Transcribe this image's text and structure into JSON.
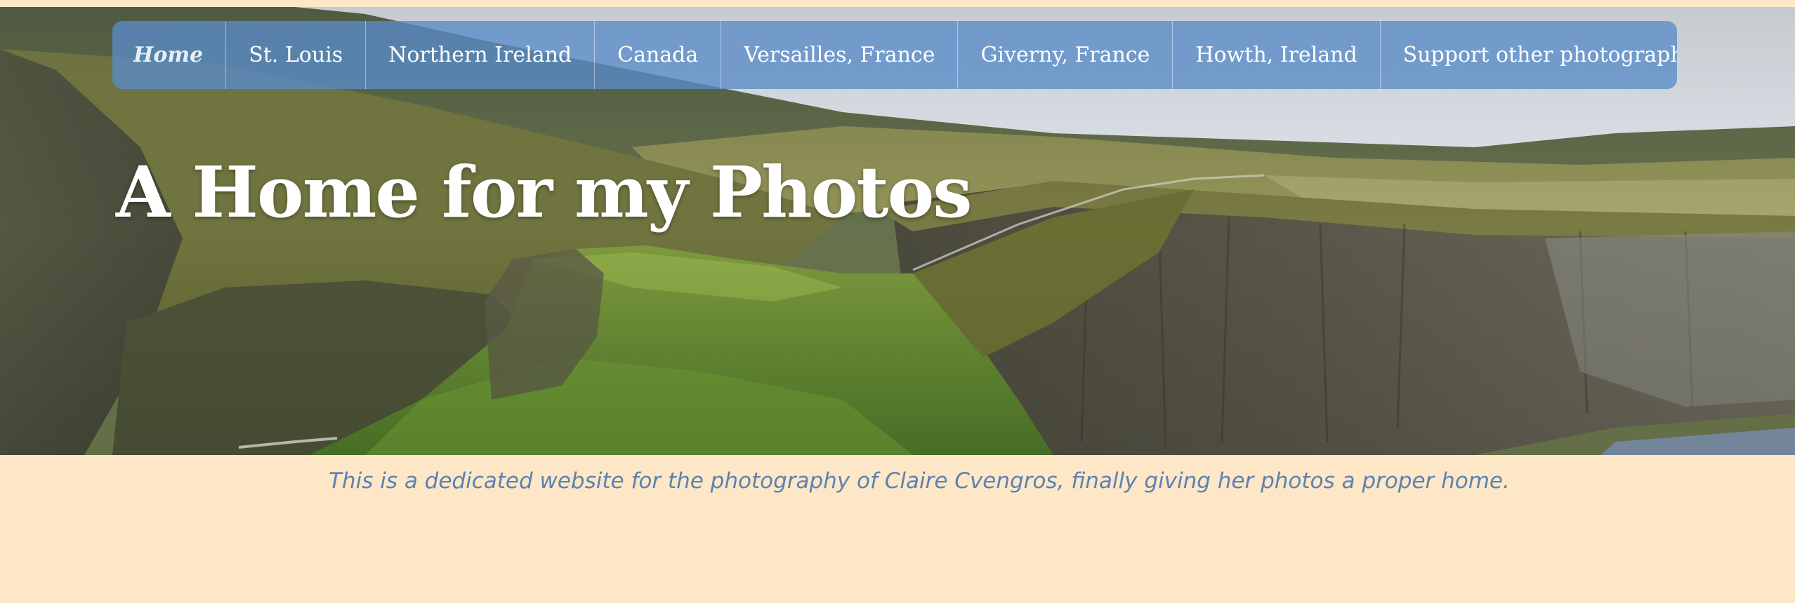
{
  "nav": {
    "items": [
      {
        "label": "Home",
        "active": true
      },
      {
        "label": "St. Louis",
        "active": false
      },
      {
        "label": "Northern Ireland",
        "active": false
      },
      {
        "label": "Canada",
        "active": false
      },
      {
        "label": "Versailles, France",
        "active": false
      },
      {
        "label": "Giverny, France",
        "active": false
      },
      {
        "label": "Howth, Ireland",
        "active": false
      },
      {
        "label": "Support other photographers!",
        "active": false
      }
    ]
  },
  "hero": {
    "title": "A Home for my Photos",
    "image_subject": "coastal-cliffs-landscape"
  },
  "tagline": "This is a dedicated website for the photography of Claire Cvengros, finally giving her photos a proper home.",
  "colors": {
    "page_background": "#fde7c6",
    "nav_background": "#588cc8",
    "tagline_text": "#5b82b3",
    "title_text": "#ffffff"
  }
}
